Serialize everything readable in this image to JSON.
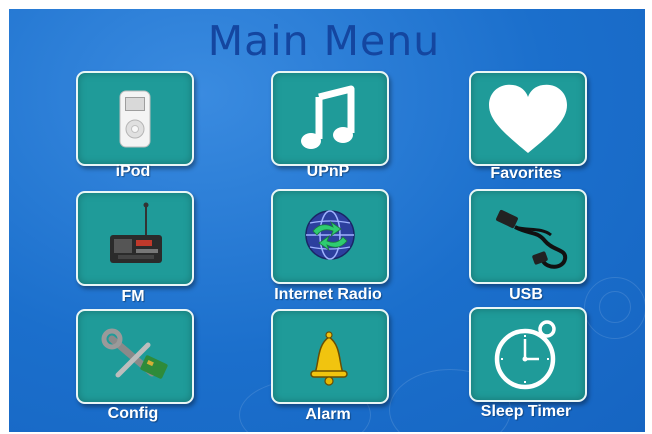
{
  "title": "Main Menu",
  "menu": {
    "items": [
      {
        "label": "iPod",
        "icon": "ipod-icon"
      },
      {
        "label": "UPnP",
        "icon": "music-note-icon"
      },
      {
        "label": "Favorites",
        "icon": "heart-icon"
      },
      {
        "label": "FM",
        "icon": "radio-icon"
      },
      {
        "label": "Internet Radio",
        "icon": "globe-icon"
      },
      {
        "label": "USB",
        "icon": "usb-cable-icon"
      },
      {
        "label": "Config",
        "icon": "tools-icon"
      },
      {
        "label": "Alarm",
        "icon": "bell-icon"
      },
      {
        "label": "Sleep Timer",
        "icon": "stopwatch-icon"
      }
    ]
  },
  "colors": {
    "background": "#1b6fcc",
    "tile": "#1f9b99",
    "title": "#1446a0",
    "label": "#ffffff"
  }
}
